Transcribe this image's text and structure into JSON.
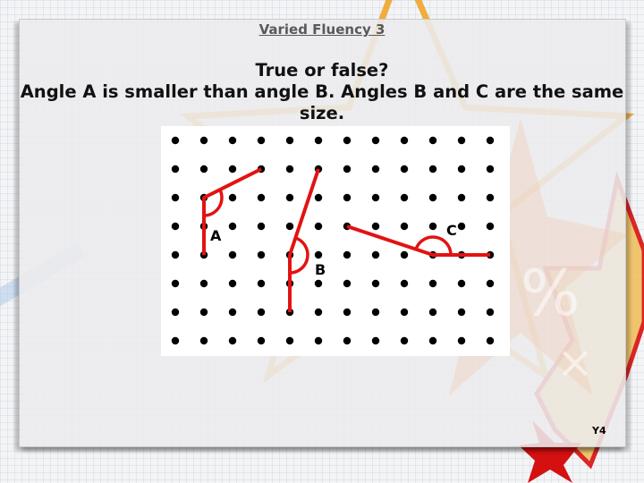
{
  "slide": {
    "title": "Varied Fluency 3",
    "question_line1": "True or false?",
    "question_line2": "Angle A is smaller than angle B. Angles B and C are the same size.",
    "year_label": "Y4"
  },
  "dot_grid": {
    "columns": 12,
    "rows": 8,
    "dot_color": "#000000",
    "line_color": "#e31212"
  },
  "angles": [
    {
      "label": "A",
      "vertex": [
        1,
        2
      ],
      "arm1": [
        3,
        1
      ],
      "arm2": [
        1,
        4
      ]
    },
    {
      "label": "B",
      "vertex": [
        4,
        4
      ],
      "arm1": [
        5,
        1
      ],
      "arm2": [
        4,
        6
      ]
    },
    {
      "label": "C",
      "vertex": [
        9,
        4
      ],
      "arm1": [
        6,
        3
      ],
      "arm2": [
        11,
        4
      ]
    }
  ],
  "colors": {
    "accent_red": "#e31212",
    "title_gray": "#595959",
    "star_orange": "#f0a020"
  }
}
